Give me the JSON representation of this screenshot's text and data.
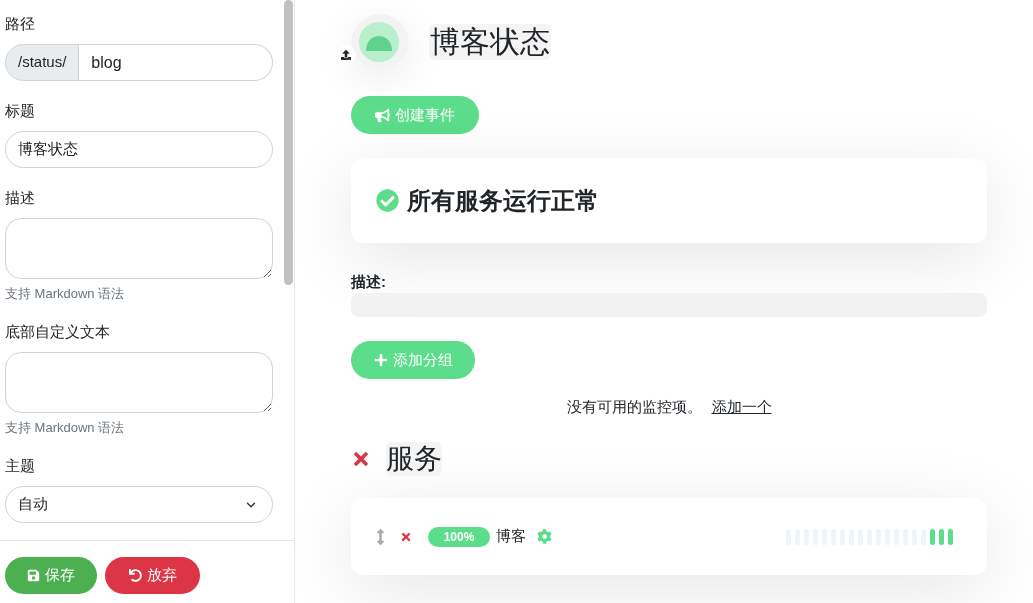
{
  "sidebar": {
    "fields": [
      {
        "kind": "prefixed",
        "label": "路径",
        "prefix": "/status/",
        "value": "blog"
      },
      {
        "kind": "text",
        "label": "标题",
        "value": "博客状态"
      },
      {
        "kind": "textarea",
        "label": "描述",
        "hint": "支持 Markdown 语法"
      },
      {
        "kind": "textarea",
        "label": "底部自定义文本",
        "hint": "支持 Markdown 语法"
      },
      {
        "kind": "select",
        "label": "主题",
        "value": "自动"
      }
    ],
    "buttons": [
      {
        "kind": "save",
        "label": "保存"
      },
      {
        "kind": "discard",
        "label": "放弃"
      }
    ]
  },
  "page": {
    "title": "博客状态",
    "create_incident_button": "创建事件",
    "overall_status": {
      "ok": true,
      "text": "所有服务运行正常"
    },
    "description_label": "描述:",
    "add_group_button": "添加分组",
    "empty_notice": {
      "text": "没有可用的监控项。",
      "link": "添加一个"
    },
    "groups": [
      {
        "name": "服务",
        "monitors": [
          {
            "uptime": "100%",
            "name": "博客",
            "heartbeats": [
              {
                "up": false
              },
              {
                "up": false
              },
              {
                "up": false
              },
              {
                "up": false
              },
              {
                "up": false
              },
              {
                "up": false
              },
              {
                "up": false
              },
              {
                "up": false
              },
              {
                "up": false
              },
              {
                "up": false
              },
              {
                "up": false
              },
              {
                "up": false
              },
              {
                "up": false
              },
              {
                "up": false
              },
              {
                "up": false
              },
              {
                "up": false
              },
              {
                "up": true
              },
              {
                "up": true
              },
              {
                "up": true
              }
            ]
          }
        ]
      }
    ]
  }
}
